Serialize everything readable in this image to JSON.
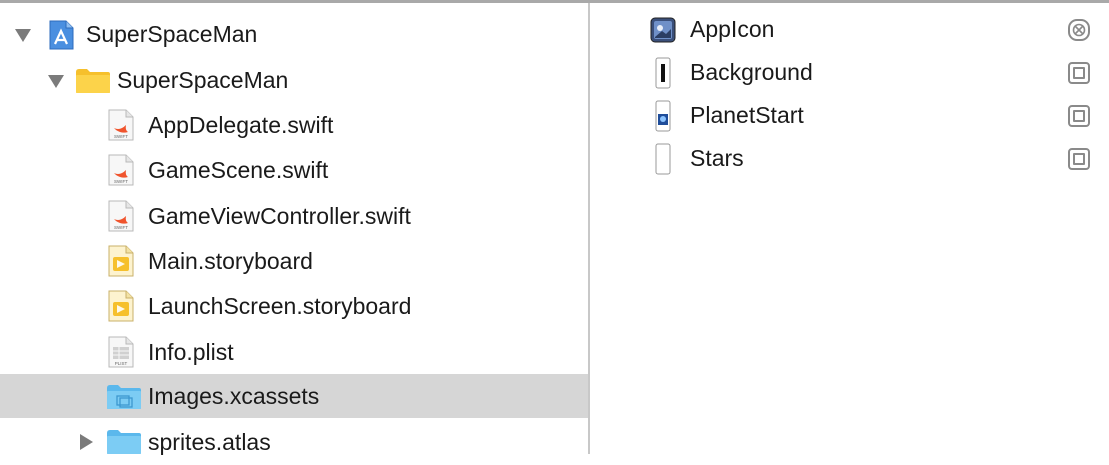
{
  "navigator": {
    "items": [
      {
        "label": "SuperSpaceMan",
        "icon": "project-icon"
      },
      {
        "label": "SuperSpaceMan",
        "icon": "folder-icon"
      },
      {
        "label": "AppDelegate.swift",
        "icon": "swift-file-icon",
        "badge": "SWIFT"
      },
      {
        "label": "GameScene.swift",
        "icon": "swift-file-icon",
        "badge": "SWIFT"
      },
      {
        "label": "GameViewController.swift",
        "icon": "swift-file-icon",
        "badge": "SWIFT"
      },
      {
        "label": "Main.storyboard",
        "icon": "storyboard-icon"
      },
      {
        "label": "LaunchScreen.storyboard",
        "icon": "storyboard-icon"
      },
      {
        "label": "Info.plist",
        "icon": "plist-icon",
        "badge": "PLIST"
      },
      {
        "label": "Images.xcassets",
        "icon": "xcassets-folder-icon",
        "selected": true
      },
      {
        "label": "sprites.atlas",
        "icon": "folder-icon"
      }
    ]
  },
  "assets": {
    "items": [
      {
        "label": "AppIcon",
        "icon": "app-icon-thumb",
        "check_state": "mixed"
      },
      {
        "label": "Background",
        "icon": "image-set-thumb",
        "check_state": "unchecked"
      },
      {
        "label": "PlanetStart",
        "icon": "image-set-thumb",
        "check_state": "unchecked"
      },
      {
        "label": "Stars",
        "icon": "image-set-thumb",
        "check_state": "unchecked"
      }
    ]
  },
  "colors": {
    "selection": "#d6d6d6",
    "folder_yellow": "#f6c02c",
    "folder_blue": "#5bb8ec",
    "swift_orange": "#f0542d"
  }
}
